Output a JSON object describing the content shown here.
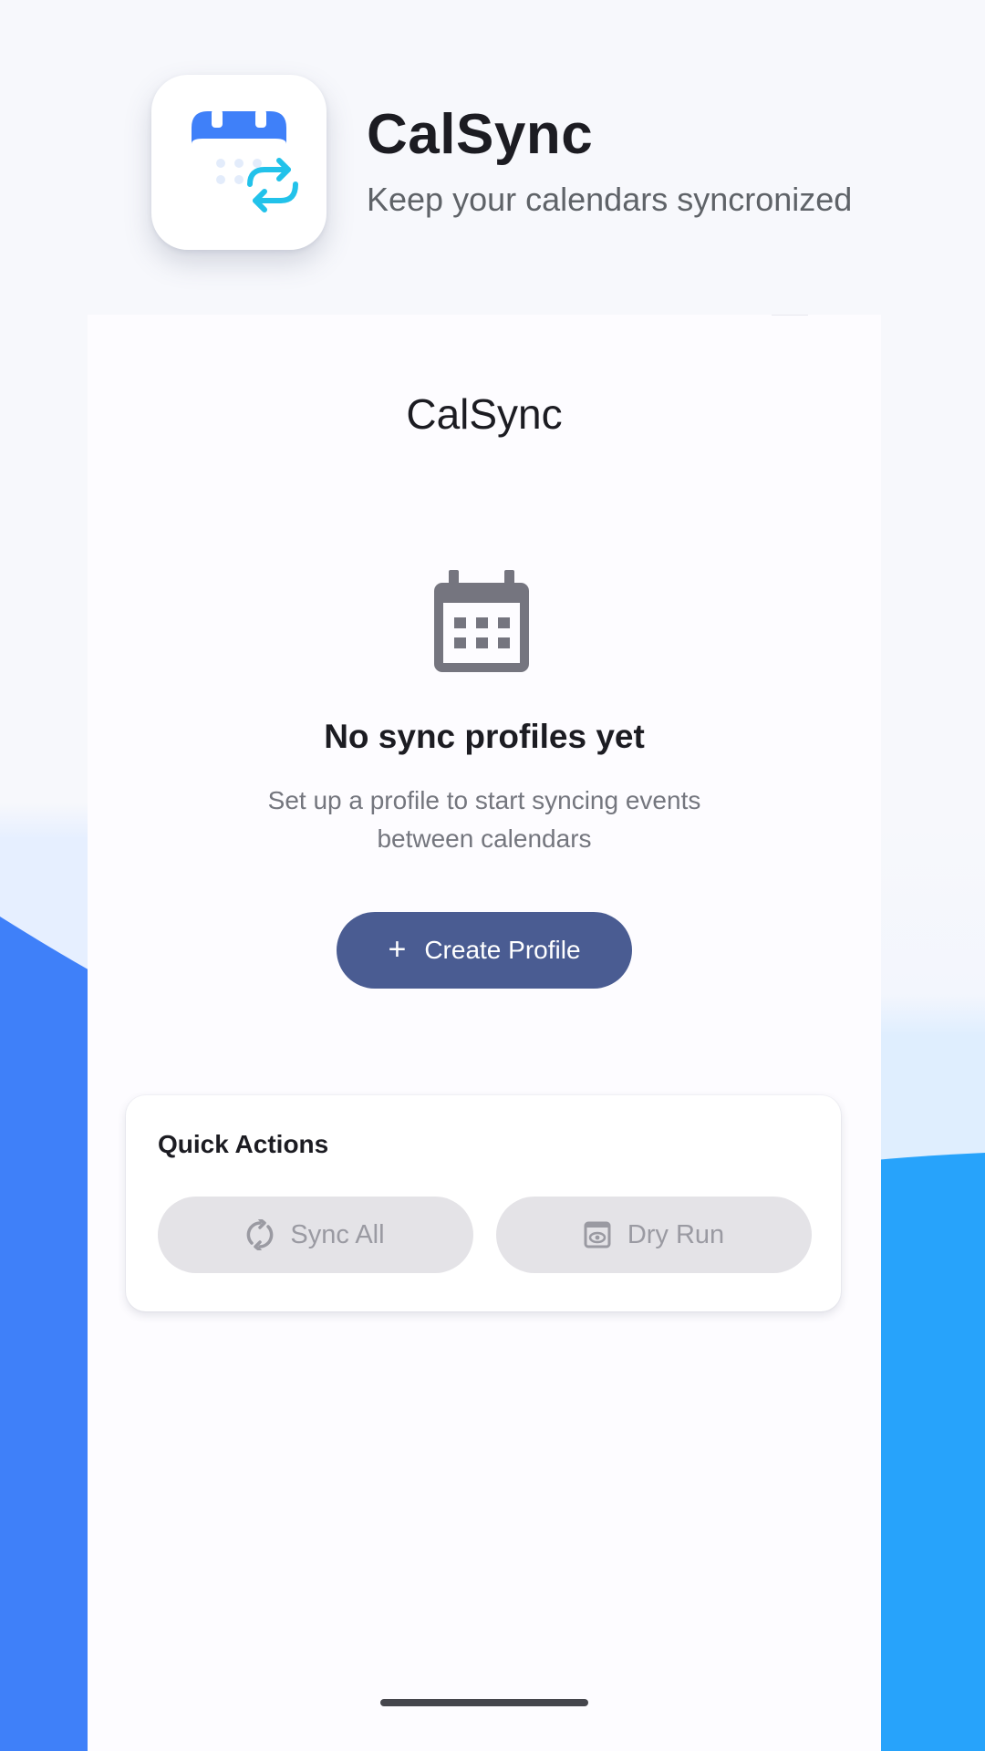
{
  "hero": {
    "app_name": "CalSync",
    "tagline": "Keep your calendars syncronized",
    "icon": "calendar-sync-icon"
  },
  "app_bar": {
    "title": "CalSync"
  },
  "empty_state": {
    "icon": "calendar-icon",
    "title": "No sync profiles yet",
    "description": "Set up a profile to start syncing events between calendars",
    "create_button": {
      "icon": "plus-icon",
      "label": "Create Profile"
    }
  },
  "quick_actions": {
    "title": "Quick Actions",
    "sync_all": {
      "icon": "sync-icon",
      "label": "Sync All"
    },
    "dry_run": {
      "icon": "preview-icon",
      "label": "Dry Run"
    }
  },
  "colors": {
    "primary_button": "#4a5c92",
    "background_left": "#3d7ef8",
    "background_right": "#27a3fb",
    "disabled_button": "#e4e3e7"
  }
}
